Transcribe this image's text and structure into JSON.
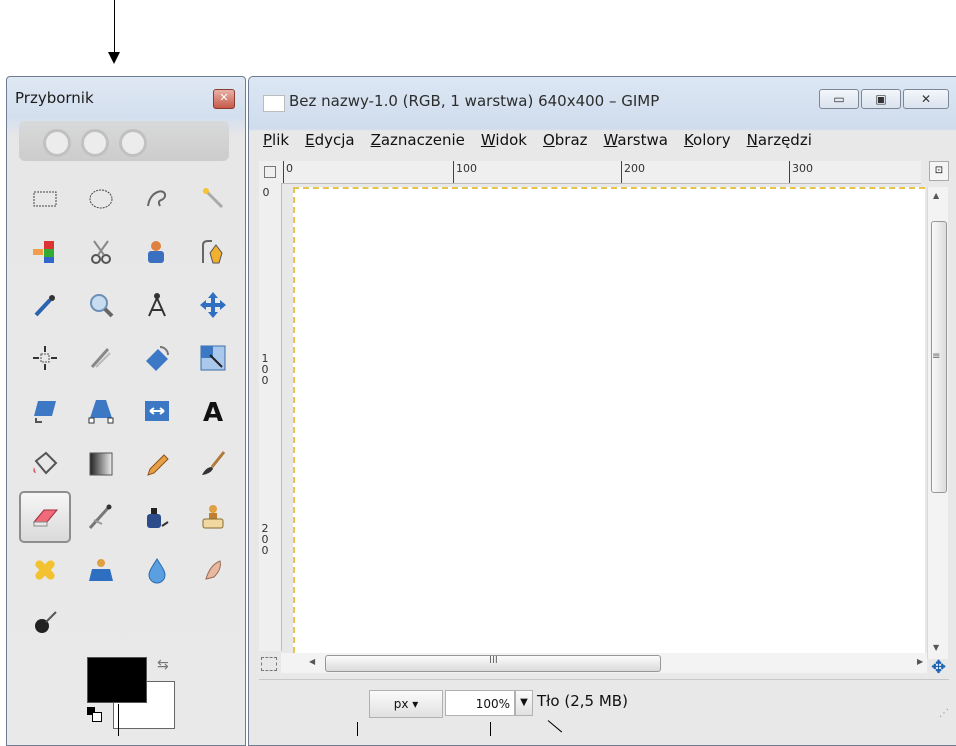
{
  "toolbox": {
    "title": "Przybornik",
    "close_label": "✕",
    "tools": [
      {
        "name": "rect-select-icon"
      },
      {
        "name": "ellipse-select-icon"
      },
      {
        "name": "free-select-icon"
      },
      {
        "name": "fuzzy-select-icon"
      },
      {
        "name": "color-select-icon"
      },
      {
        "name": "scissors-select-icon"
      },
      {
        "name": "foreground-select-icon"
      },
      {
        "name": "paths-icon"
      },
      {
        "name": "color-picker-icon"
      },
      {
        "name": "zoom-icon"
      },
      {
        "name": "measure-icon"
      },
      {
        "name": "move-icon"
      },
      {
        "name": "align-icon"
      },
      {
        "name": "crop-icon"
      },
      {
        "name": "rotate-icon"
      },
      {
        "name": "scale-icon"
      },
      {
        "name": "shear-icon"
      },
      {
        "name": "perspective-icon"
      },
      {
        "name": "flip-icon"
      },
      {
        "name": "text-icon"
      },
      {
        "name": "bucket-fill-icon"
      },
      {
        "name": "blend-icon"
      },
      {
        "name": "pencil-icon"
      },
      {
        "name": "paintbrush-icon"
      },
      {
        "name": "eraser-icon"
      },
      {
        "name": "airbrush-icon"
      },
      {
        "name": "ink-icon"
      },
      {
        "name": "clone-icon"
      },
      {
        "name": "heal-icon"
      },
      {
        "name": "perspective-clone-icon"
      },
      {
        "name": "blur-sharpen-icon"
      },
      {
        "name": "smudge-icon"
      },
      {
        "name": "dodge-burn-icon"
      }
    ],
    "selected_tool": "eraser-icon",
    "foreground_color": "#000000",
    "background_color": "#ffffff"
  },
  "image_window": {
    "title": "Bez nazwy-1.0 (RGB, 1 warstwa) 640x400 – GIMP",
    "minimize": "▭",
    "maximize": "▣",
    "close": "✕",
    "menu": [
      {
        "first": "P",
        "rest": "lik"
      },
      {
        "first": "E",
        "rest": "dycja"
      },
      {
        "first": "Z",
        "rest": "aznaczenie"
      },
      {
        "first": "W",
        "rest": "idok"
      },
      {
        "first": "O",
        "rest": "braz"
      },
      {
        "first": "W",
        "rest": "arstwa"
      },
      {
        "first": "K",
        "rest": "olory"
      },
      {
        "first": "N",
        "rest": "arzędzi"
      }
    ],
    "ruler_top_labels": [
      "0",
      "100",
      "200",
      "300"
    ],
    "ruler_left_labels": [
      "0",
      "100",
      "200"
    ],
    "hscroll_label": "III",
    "vscroll_label": "≡",
    "statusbar": {
      "unit": "px",
      "zoom": "100%",
      "layer_info": "Tło (2,5 MB)"
    }
  }
}
